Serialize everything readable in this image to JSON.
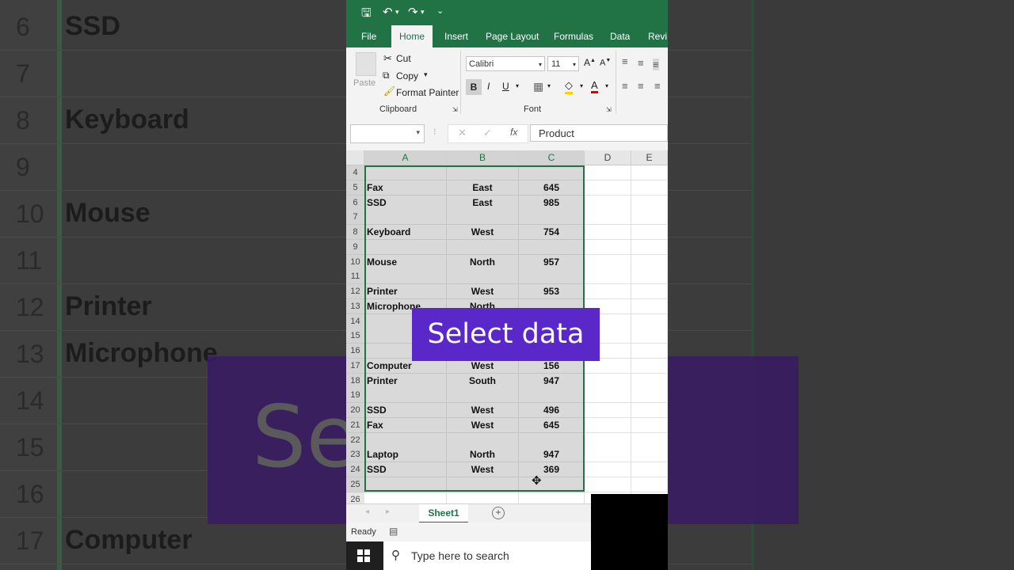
{
  "background": {
    "rows": [
      {
        "num": "6",
        "text": "SSD"
      },
      {
        "num": "7",
        "text": ""
      },
      {
        "num": "8",
        "text": "Keyboard"
      },
      {
        "num": "9",
        "text": ""
      },
      {
        "num": "10",
        "text": "Mouse"
      },
      {
        "num": "11",
        "text": ""
      },
      {
        "num": "12",
        "text": "Printer"
      },
      {
        "num": "13",
        "text": "Microphone"
      },
      {
        "num": "14",
        "text": ""
      },
      {
        "num": "15",
        "text": ""
      },
      {
        "num": "16",
        "text": ""
      },
      {
        "num": "17",
        "text": "Computer"
      }
    ],
    "banner_text": "Se    ata"
  },
  "quick_access": {
    "save": "🖫",
    "undo": "↶",
    "redo": "↷",
    "more": "⌄"
  },
  "tabs": [
    "File",
    "Home",
    "Insert",
    "Page Layout",
    "Formulas",
    "Data",
    "Revi"
  ],
  "active_tab": "Home",
  "clipboard": {
    "paste": "Paste",
    "cut": "Cut",
    "copy": "Copy",
    "format_painter": "Format Painter",
    "label": "Clipboard"
  },
  "font": {
    "name": "Calibri",
    "size": "11",
    "bold": "B",
    "italic": "I",
    "underline": "U",
    "label": "Font"
  },
  "formula_bar": {
    "fx": "fx",
    "value": "Product"
  },
  "columns": [
    "A",
    "B",
    "C",
    "D",
    "E"
  ],
  "rows": [
    {
      "num": "4",
      "a": "",
      "b": "",
      "c": ""
    },
    {
      "num": "5",
      "a": "Fax",
      "b": "East",
      "c": "645"
    },
    {
      "num": "6",
      "a": "SSD",
      "b": "East",
      "c": "985"
    },
    {
      "num": "7",
      "a": "",
      "b": "",
      "c": ""
    },
    {
      "num": "8",
      "a": "Keyboard",
      "b": "West",
      "c": "754"
    },
    {
      "num": "9",
      "a": "",
      "b": "",
      "c": ""
    },
    {
      "num": "10",
      "a": "Mouse",
      "b": "North",
      "c": "957"
    },
    {
      "num": "11",
      "a": "",
      "b": "",
      "c": ""
    },
    {
      "num": "12",
      "a": "Printer",
      "b": "West",
      "c": "953"
    },
    {
      "num": "13",
      "a": "Microphone",
      "b": "North",
      "c": ""
    },
    {
      "num": "14",
      "a": "",
      "b": "",
      "c": ""
    },
    {
      "num": "15",
      "a": "",
      "b": "",
      "c": ""
    },
    {
      "num": "16",
      "a": "",
      "b": "",
      "c": ""
    },
    {
      "num": "17",
      "a": "Computer",
      "b": "West",
      "c": "156"
    },
    {
      "num": "18",
      "a": "Printer",
      "b": "South",
      "c": "947"
    },
    {
      "num": "19",
      "a": "",
      "b": "",
      "c": ""
    },
    {
      "num": "20",
      "a": "SSD",
      "b": "West",
      "c": "496"
    },
    {
      "num": "21",
      "a": "Fax",
      "b": "West",
      "c": "645"
    },
    {
      "num": "22",
      "a": "",
      "b": "",
      "c": ""
    },
    {
      "num": "23",
      "a": "Laptop",
      "b": "North",
      "c": "947"
    },
    {
      "num": "24",
      "a": "SSD",
      "b": "West",
      "c": "369"
    },
    {
      "num": "25",
      "a": "",
      "b": "",
      "c": ""
    },
    {
      "num": "26",
      "a": "",
      "b": "",
      "c": ""
    }
  ],
  "sheet_tab": "Sheet1",
  "status": "Ready",
  "taskbar": {
    "search_placeholder": "Type here to search"
  },
  "overlay_caption": "Select data",
  "colors": {
    "excel_green": "#217346",
    "overlay_purple": "#5a27c8"
  }
}
